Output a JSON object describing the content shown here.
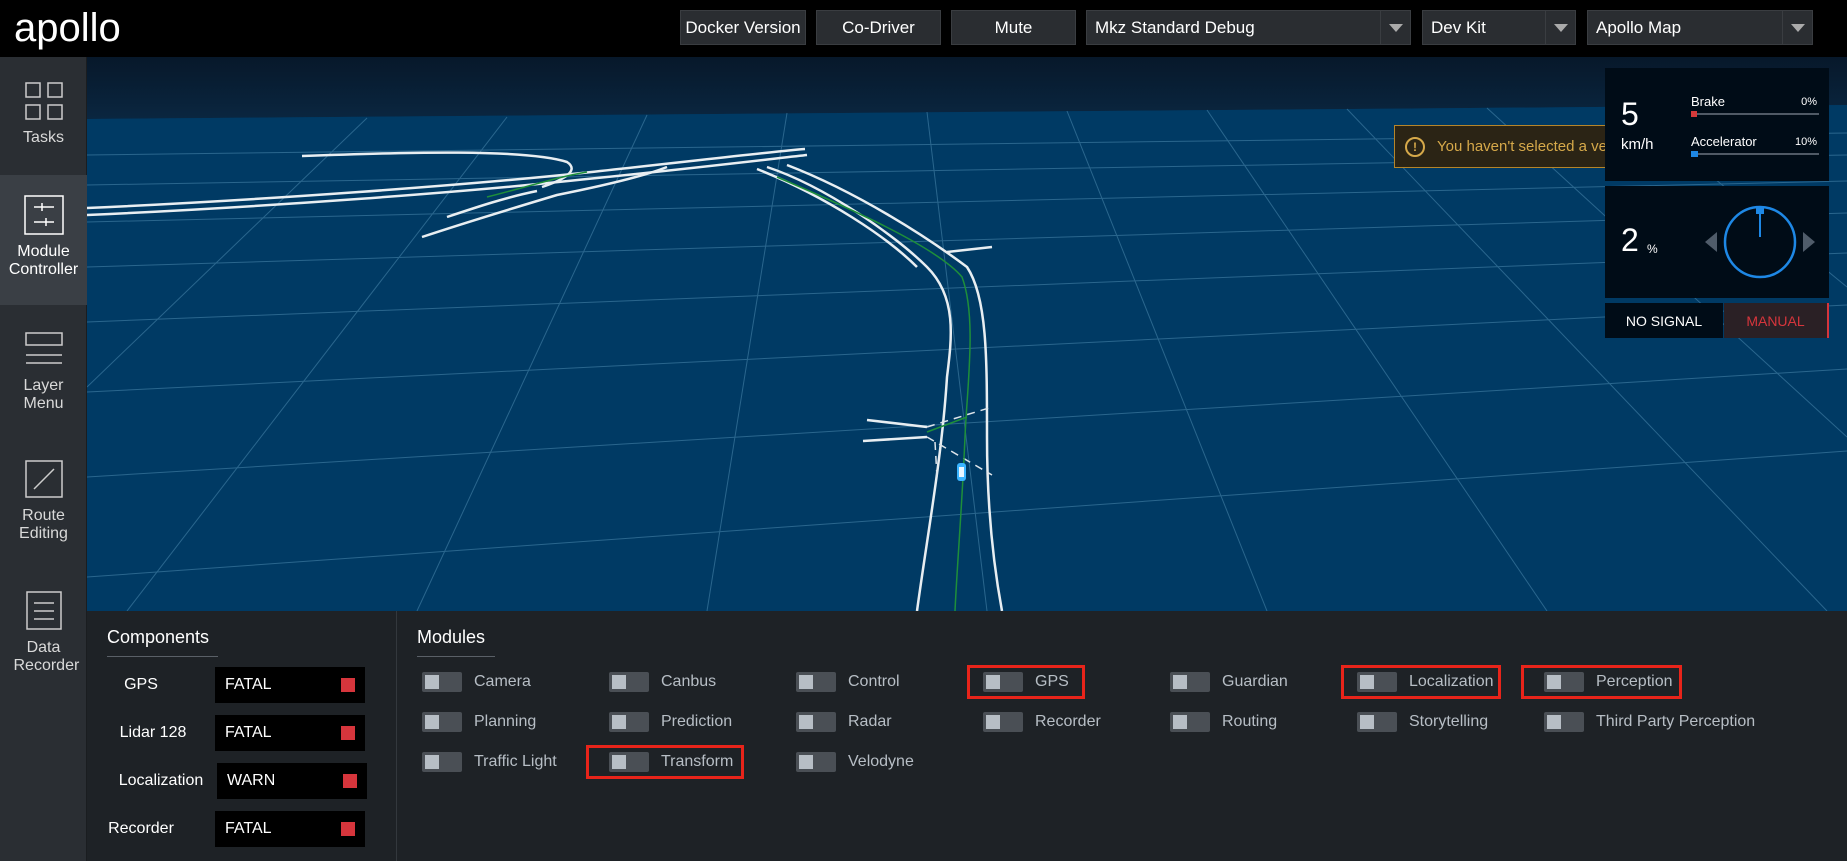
{
  "header": {
    "logo": "apollo",
    "buttons": [
      "Docker Version",
      "Co-Driver",
      "Mute"
    ],
    "selects": [
      {
        "value": "Mkz Standard Debug"
      },
      {
        "value": "Dev Kit"
      },
      {
        "value": "Apollo Map"
      }
    ]
  },
  "sidebar": {
    "items": [
      {
        "label": "Tasks",
        "icon": "grid-icon"
      },
      {
        "label": "Module Controller",
        "icon": "sliders-icon",
        "active": true
      },
      {
        "label": "Layer Menu",
        "icon": "layers-icon"
      },
      {
        "label": "Route Editing",
        "icon": "route-icon"
      },
      {
        "label": "Data Recorder",
        "icon": "document-icon"
      }
    ]
  },
  "scene": {
    "warning": "You haven't selected a vehicle yet!",
    "speed": "5",
    "speed_unit": "km/h",
    "brake_label": "Brake",
    "brake_pct": "0%",
    "brake_value": 0,
    "accel_label": "Accelerator",
    "accel_pct": "10%",
    "accel_value": 0.1,
    "steering_value": "2",
    "steering_unit": "%",
    "signal": "NO SIGNAL",
    "mode": "MANUAL"
  },
  "components": {
    "title": "Components",
    "rows": [
      {
        "name": "GPS",
        "status": "FATAL"
      },
      {
        "name": "Lidar 128",
        "status": "FATAL"
      },
      {
        "name": "Localization",
        "status": "WARN"
      },
      {
        "name": "Recorder",
        "status": "FATAL"
      }
    ]
  },
  "modules": {
    "title": "Modules",
    "items": [
      {
        "name": "Camera"
      },
      {
        "name": "Canbus"
      },
      {
        "name": "Control"
      },
      {
        "name": "GPS",
        "highlighted": true
      },
      {
        "name": "Guardian"
      },
      {
        "name": "Localization",
        "highlighted": true
      },
      {
        "name": "Perception",
        "highlighted": true
      },
      {
        "name": "Planning"
      },
      {
        "name": "Prediction"
      },
      {
        "name": "Radar"
      },
      {
        "name": "Recorder"
      },
      {
        "name": "Routing"
      },
      {
        "name": "Storytelling"
      },
      {
        "name": "Third Party Perception"
      },
      {
        "name": "Traffic Light"
      },
      {
        "name": "Transform",
        "highlighted": true
      },
      {
        "name": "Velodyne"
      }
    ]
  },
  "colors": {
    "fatal": "#d6353c",
    "highlight": "#e8241a",
    "accent": "#1e88e5"
  }
}
